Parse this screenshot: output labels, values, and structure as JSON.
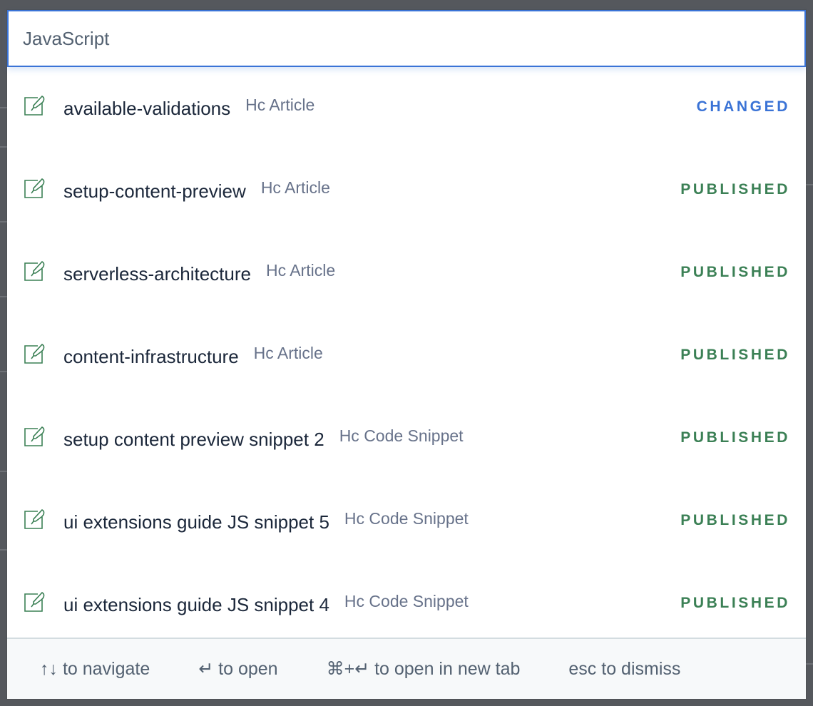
{
  "search": {
    "value": "JavaScript",
    "placeholder": ""
  },
  "results": [
    {
      "title": "available-validations",
      "type": "Hc Article",
      "status": "CHANGED",
      "icon": "entry-edit-icon"
    },
    {
      "title": "setup-content-preview",
      "type": "Hc Article",
      "status": "PUBLISHED",
      "icon": "entry-edit-icon"
    },
    {
      "title": "serverless-architecture",
      "type": "Hc Article",
      "status": "PUBLISHED",
      "icon": "entry-edit-icon"
    },
    {
      "title": "content-infrastructure",
      "type": "Hc Article",
      "status": "PUBLISHED",
      "icon": "entry-edit-icon"
    },
    {
      "title": "setup content preview snippet 2",
      "type": "Hc Code Snippet",
      "status": "PUBLISHED",
      "icon": "entry-edit-icon"
    },
    {
      "title": "ui extensions guide JS snippet 5",
      "type": "Hc Code Snippet",
      "status": "PUBLISHED",
      "icon": "entry-edit-icon"
    },
    {
      "title": "ui extensions guide JS snippet 4",
      "type": "Hc Code Snippet",
      "status": "PUBLISHED",
      "icon": "entry-edit-icon"
    }
  ],
  "footer": {
    "navigate": "↑↓ to navigate",
    "open": "↵ to open",
    "open_new_tab": "⌘+↵ to open in new tab",
    "dismiss": "esc to dismiss"
  },
  "colors": {
    "accent": "#3a73d6",
    "changed": "#3a73d6",
    "published": "#3b8055",
    "icon": "#3b8055",
    "overlay": "#55585d"
  }
}
